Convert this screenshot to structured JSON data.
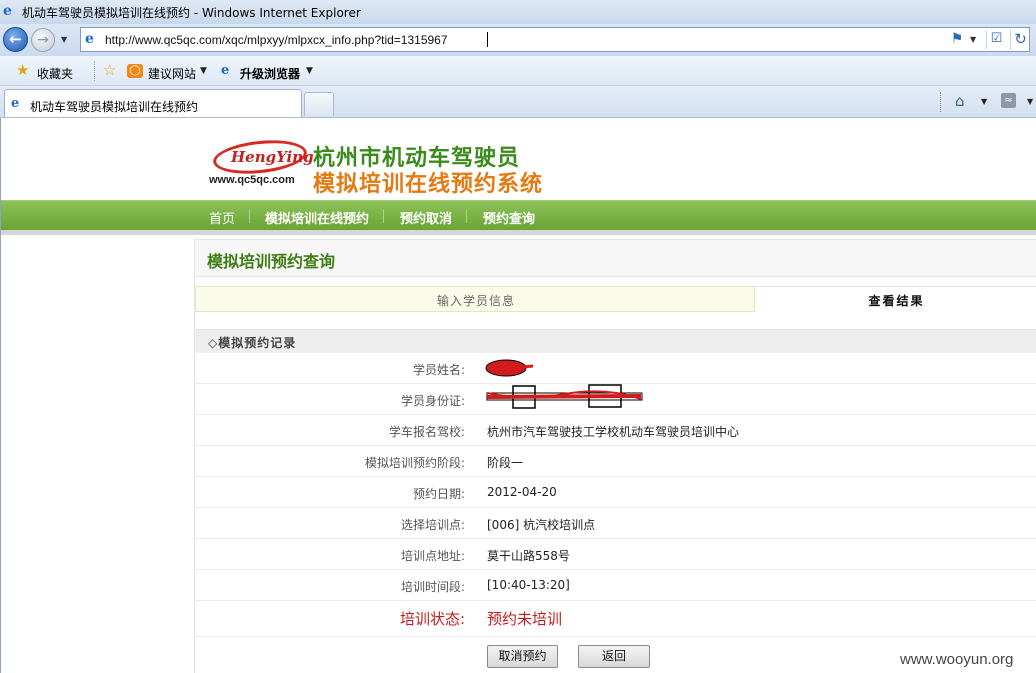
{
  "window": {
    "title": "机动车驾驶员模拟培训在线预约 - Windows Internet Explorer"
  },
  "address": {
    "url": "http://www.qc5qc.com/xqc/mlpxyy/mlpxcx_info.php?tid=1315967"
  },
  "favorites_bar": {
    "favorites_label": "收藏夹",
    "suggested_sites_label": "建议网站",
    "upgrade_label": "升级浏览器"
  },
  "tab": {
    "label": "机动车驾驶员模拟培训在线预约"
  },
  "site": {
    "brand": "HengYing",
    "domain": "www.qc5qc.com",
    "title_line1": "杭州市机动车驾驶员",
    "title_line2": "模拟培训在线预约系统"
  },
  "nav": [
    {
      "label": "首页"
    },
    {
      "label": "模拟培训在线预约"
    },
    {
      "label": "预约取消"
    },
    {
      "label": "预约查询"
    }
  ],
  "section_title": "模拟培训预约查询",
  "steps": {
    "step1": "输入学员信息",
    "step2": "查看结果"
  },
  "record_header": "◇模拟预约记录",
  "record": [
    {
      "label": "学员姓名:",
      "value": ""
    },
    {
      "label": "学员身份证:",
      "value": ""
    },
    {
      "label": "学车报名驾校:",
      "value": "杭州市汽车驾驶技工学校机动车驾驶员培训中心"
    },
    {
      "label": "模拟培训预约阶段:",
      "value": "阶段一"
    },
    {
      "label": "预约日期:",
      "value": "2012-04-20"
    },
    {
      "label": "选择培训点:",
      "value": "[006] 杭汽校培训点"
    },
    {
      "label": "培训点地址:",
      "value": "莫干山路558号"
    },
    {
      "label": "培训时间段:",
      "value": "[10:40-13:20]"
    }
  ],
  "status": {
    "label": "培训状态:",
    "value": "预约未培训"
  },
  "buttons": {
    "cancel": "取消预约",
    "back": "返回"
  },
  "watermark": "www.wooyun.org",
  "colors": {
    "nav_green": "#6aa534",
    "title_green": "#3f7d13",
    "logo_orange": "#e37b12",
    "status_red": "#c41b1b"
  }
}
